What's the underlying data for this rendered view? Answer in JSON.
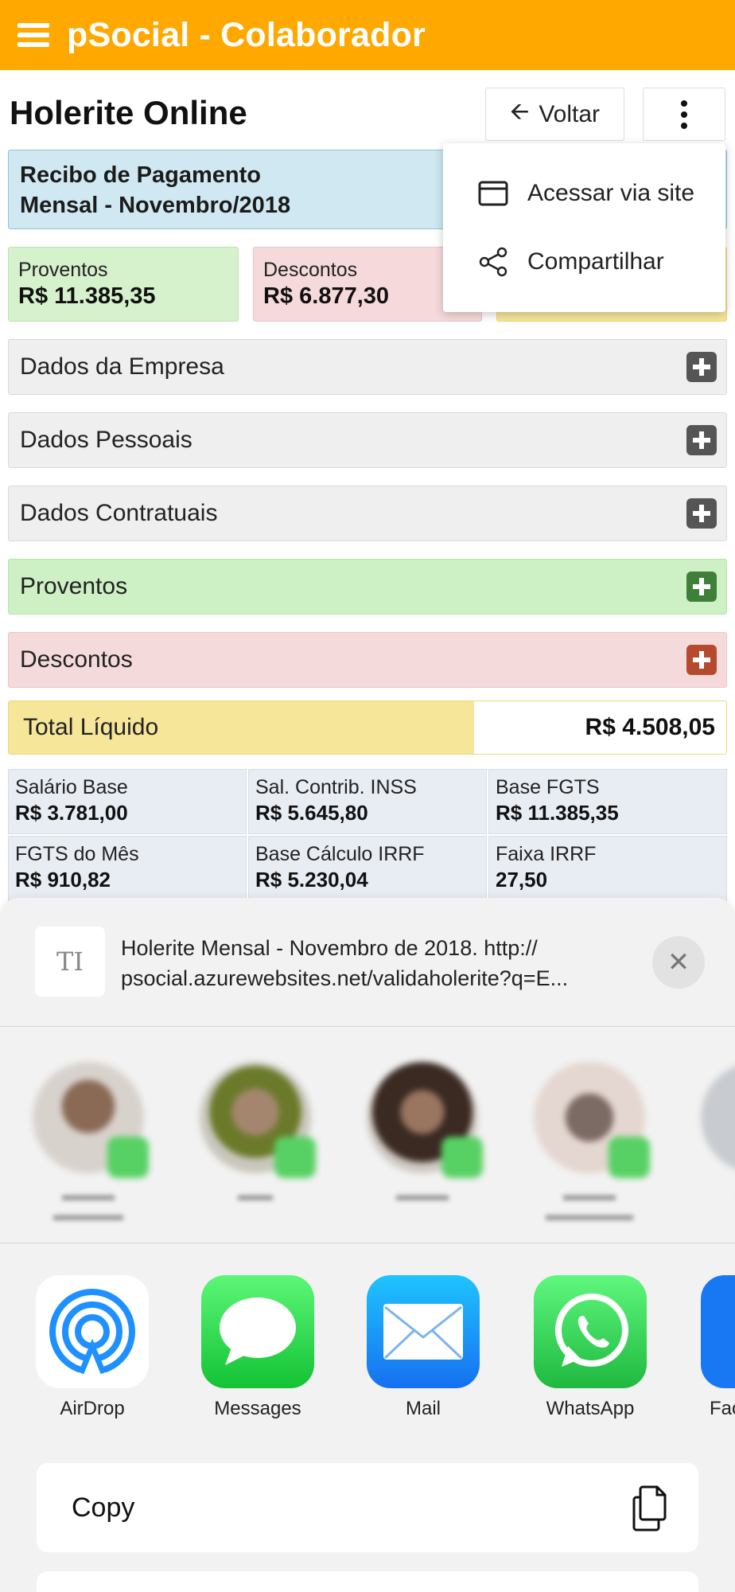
{
  "app": {
    "title": "pSocial - Colaborador"
  },
  "header": {
    "title": "Holerite Online",
    "back_label": "Voltar"
  },
  "receipt": {
    "line1": "Recibo de Pagamento",
    "line2": "Mensal - Novembro/2018"
  },
  "summary": {
    "proventos": {
      "label": "Proventos",
      "value": "R$ 11.385,35"
    },
    "descontos": {
      "label": "Descontos",
      "value": "R$ 6.877,30"
    }
  },
  "menu": {
    "items": [
      {
        "label": "Acessar via site",
        "icon": "browser-window-icon"
      },
      {
        "label": "Compartilhar",
        "icon": "share-icon"
      }
    ]
  },
  "sections": [
    {
      "label": "Dados da Empresa"
    },
    {
      "label": "Dados Pessoais"
    },
    {
      "label": "Dados Contratuais"
    },
    {
      "label": "Proventos"
    },
    {
      "label": "Descontos"
    }
  ],
  "total": {
    "label": "Total Líquido",
    "value": "R$ 4.508,05"
  },
  "info": [
    {
      "label": "Salário Base",
      "value": "R$ 3.781,00"
    },
    {
      "label": "Sal. Contrib. INSS",
      "value": "R$ 5.645,80"
    },
    {
      "label": "Base FGTS",
      "value": "R$ 11.385,35"
    },
    {
      "label": "FGTS do Mês",
      "value": "R$ 910,82"
    },
    {
      "label": "Base Cálculo IRRF",
      "value": "R$ 5.230,04"
    },
    {
      "label": "Faixa IRRF",
      "value": "27,50"
    }
  ],
  "share": {
    "text_line1": "Holerite Mensal - Novembro de 2018.  http://",
    "text_line2": "psocial.azurewebsites.net/validaholerite?q=E...",
    "apps": [
      {
        "label": "AirDrop"
      },
      {
        "label": "Messages"
      },
      {
        "label": "Mail"
      },
      {
        "label": "WhatsApp"
      },
      {
        "label": "Fac"
      }
    ],
    "copy_label": "Copy"
  },
  "colors": {
    "brand": "#FFA800",
    "proventos": "#D6F2CC",
    "descontos": "#F6DADB",
    "liquido": "#F5E69A",
    "info": "#E8ECF3"
  }
}
